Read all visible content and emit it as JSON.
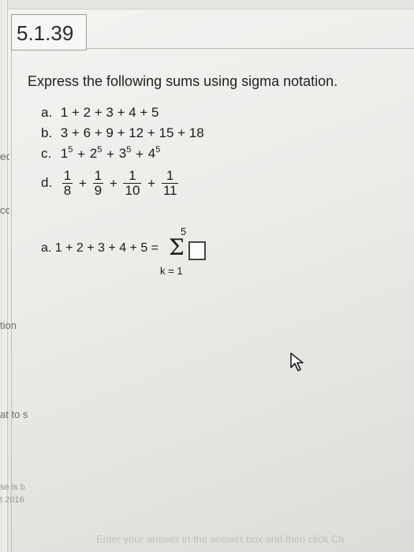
{
  "adjacent_panel": {
    "fragments": [
      "ed",
      "cor",
      "tion",
      "at to s",
      "se is b",
      "t 2016"
    ]
  },
  "question": {
    "number": "5.1.39",
    "instruction": "Express the following sums using sigma notation.",
    "items": {
      "a": {
        "label": "a.",
        "text": "1 + 2 + 3 + 4 + 5"
      },
      "b": {
        "label": "b.",
        "text": "3 + 6 + 9 + 12 + 15 + 18"
      },
      "c": {
        "label": "c.",
        "bases": [
          "1",
          "2",
          "3",
          "4"
        ],
        "exponent": "5"
      },
      "d": {
        "label": "d.",
        "numerators": [
          "1",
          "1",
          "1",
          "1"
        ],
        "denominators": [
          "8",
          "9",
          "10",
          "11"
        ]
      }
    }
  },
  "answer": {
    "label": "a. 1 + 2 + 3 + 4 + 5 =",
    "sigma": "Σ",
    "upper_limit": "5",
    "lower_limit": "k = 1",
    "input_value": ""
  },
  "footer": {
    "hint": "Enter your answer in the answer box and then click Ch"
  },
  "colors": {
    "text": "#1b1b1b",
    "border": "#9d9d9a",
    "background": "#efeeeb"
  }
}
